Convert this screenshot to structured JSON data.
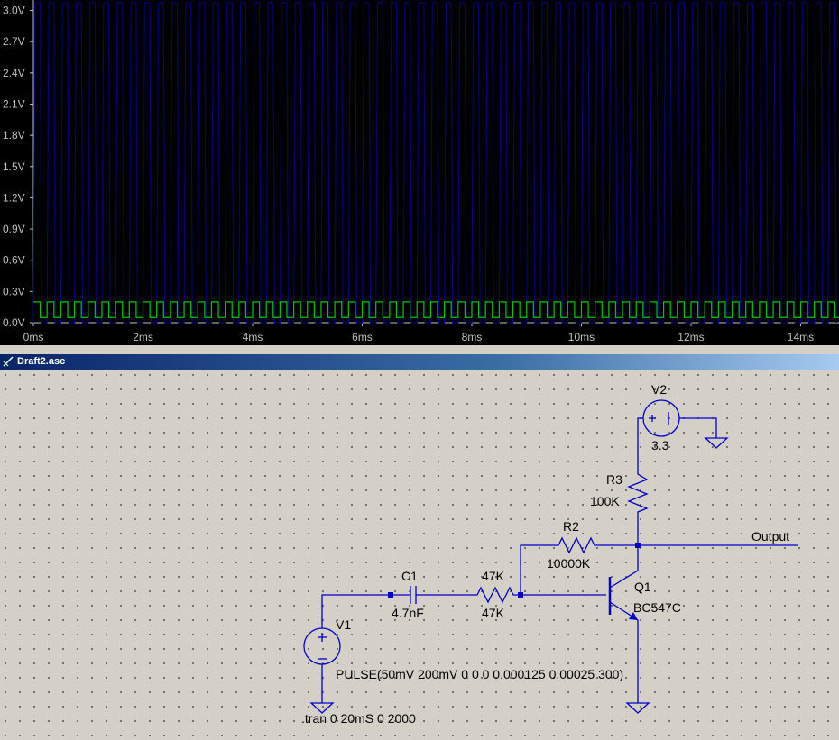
{
  "window": {
    "title": "Draft2.asc"
  },
  "plot": {
    "y_ticks": [
      "3.0V",
      "2.7V",
      "2.4V",
      "2.1V",
      "1.8V",
      "1.5V",
      "1.2V",
      "0.9V",
      "0.6V",
      "0.3V",
      "0.0V"
    ],
    "x_ticks": [
      "0ms",
      "2ms",
      "4ms",
      "6ms",
      "8ms",
      "10ms",
      "12ms",
      "14ms"
    ],
    "colors": {
      "output": "#00007c",
      "input": "#00c800",
      "background": "#000000",
      "axis": "#c0c0c0"
    }
  },
  "chart_data": {
    "type": "line",
    "xlim": [
      0,
      14.7
    ],
    "ylim": [
      0,
      3.1
    ],
    "series": [
      {
        "period_ms": 0.25,
        "low": 0.0,
        "high": 3.3
      },
      {
        "period_ms": 0.25,
        "low": 0.05,
        "high": 0.2
      }
    ]
  },
  "schematic": {
    "V2": {
      "name": "V2",
      "value": "3.3"
    },
    "R3": {
      "name": "R3",
      "value": "100K"
    },
    "R2": {
      "name": "R2",
      "value": "10000K"
    },
    "R1": {
      "name": "47K",
      "value": "47K"
    },
    "C1": {
      "name": "C1",
      "value": "4.7nF"
    },
    "Q1": {
      "name": "Q1",
      "value": "BC547C"
    },
    "V1": {
      "name": "V1",
      "value": "PULSE(50mV 200mV 0 0 0 0.000125 0.00025 300)"
    },
    "output_label": "Output",
    "directive": ".tran 0 20mS 0 2000"
  }
}
